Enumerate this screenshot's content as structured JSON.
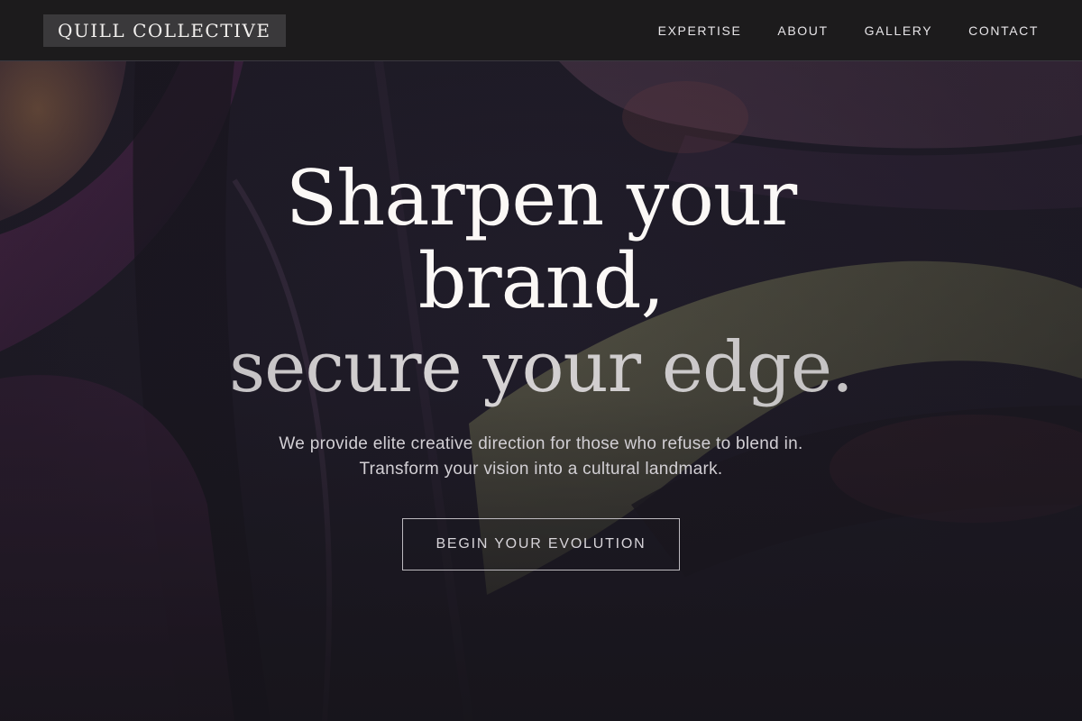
{
  "brand": {
    "name": "QUILL COLLECTIVE"
  },
  "nav": {
    "items": [
      {
        "label": "EXPERTISE"
      },
      {
        "label": "ABOUT"
      },
      {
        "label": "GALLERY"
      },
      {
        "label": "CONTACT"
      }
    ]
  },
  "hero": {
    "headline_line1": "Sharpen your",
    "headline_line2": "brand,",
    "headline_line3": "secure your edge.",
    "subtitle_line1": "We provide elite creative direction for those who refuse to blend in.",
    "subtitle_line2": "Transform your vision into a cultural landmark.",
    "cta_label": "BEGIN YOUR EVOLUTION"
  },
  "colors": {
    "nav_background": "#1c1b1c",
    "logo_background": "#3a393b",
    "headline": "#fbf8f6",
    "subtitle": "#d2cfd4",
    "accent_purple": "#6a2a5e",
    "accent_olive": "#7a7a55"
  }
}
